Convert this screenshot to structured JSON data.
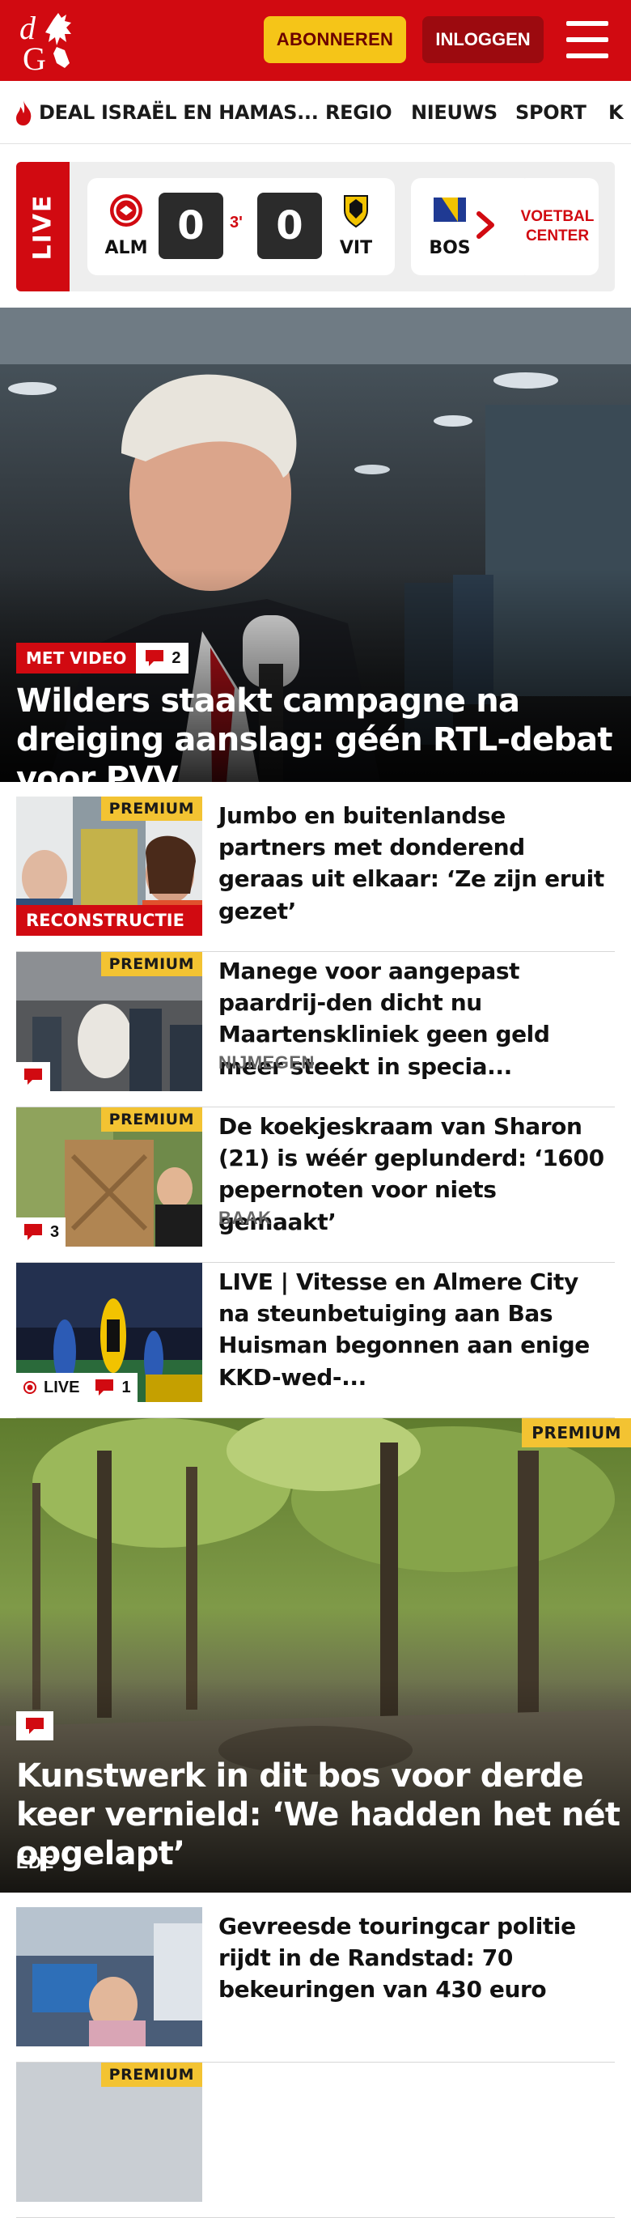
{
  "header": {
    "brand_colors": {
      "red": "#d10a11",
      "dark_red": "#9c0a0f",
      "yellow": "#f5c518"
    },
    "logo_letters": "dG",
    "subscribe_label": "ABONNEREN",
    "login_label": "INLOGGEN",
    "menu_icon": "hamburger-menu-icon"
  },
  "nav": {
    "items": [
      {
        "label": "DEAL ISRAËL EN HAMAS...",
        "icon": "flame-icon"
      },
      {
        "label": "REGIO"
      },
      {
        "label": "NIEUWS"
      },
      {
        "label": "SPORT"
      },
      {
        "label": "K"
      }
    ]
  },
  "scoreboard": {
    "live_label": "LIVE",
    "match": {
      "home": "ALM",
      "away": "VIT",
      "home_score": "0",
      "away_score": "0",
      "minute": "3'"
    },
    "next_match_team": "BOS",
    "center_label_line1": "VOETBAL",
    "center_label_line2": "CENTER"
  },
  "hero": {
    "badge_label": "MET VIDEO",
    "comment_count": "2",
    "title": "Wilders staakt campagne na dreiging aanslag: géén RTL-debat voor PVV"
  },
  "articles": [
    {
      "title": "Jumbo en buitenlandse partners met donderend geraas uit elkaar: ‘Ze zijn eruit gezet’",
      "premium": "PREMIUM",
      "tag": "RECONSTRUCTIE",
      "location": ""
    },
    {
      "title": "Manege voor aangepast paardrij-den dicht nu Maartenskliniek geen geld meer steekt in specia...",
      "premium": "PREMIUM",
      "location": "NIJMEGEN",
      "comment_count": ""
    },
    {
      "title": "De koekjeskraam van Sharon (21) is wéér geplunderd: ‘1600 pepernoten voor niets gemaakt’",
      "premium": "PREMIUM",
      "location": "BAAK",
      "comment_count": "3"
    },
    {
      "title": "LIVE | Vitesse en Almere City na steunbetuiging aan Bas Huisman begonnen aan enige KKD-wed-...",
      "live_label": "LIVE",
      "comment_count": "1"
    }
  ],
  "big_story": {
    "premium": "PREMIUM",
    "title": "Kunstwerk in dit bos voor derde keer vernield: ‘We hadden het nét opgelapt’",
    "location": "EDE"
  },
  "articles_2": [
    {
      "title": "Gevreesde touringcar politie rijdt in de Randstad: 70 bekeuringen van 430 euro"
    },
    {
      "premium": "PREMIUM"
    }
  ]
}
